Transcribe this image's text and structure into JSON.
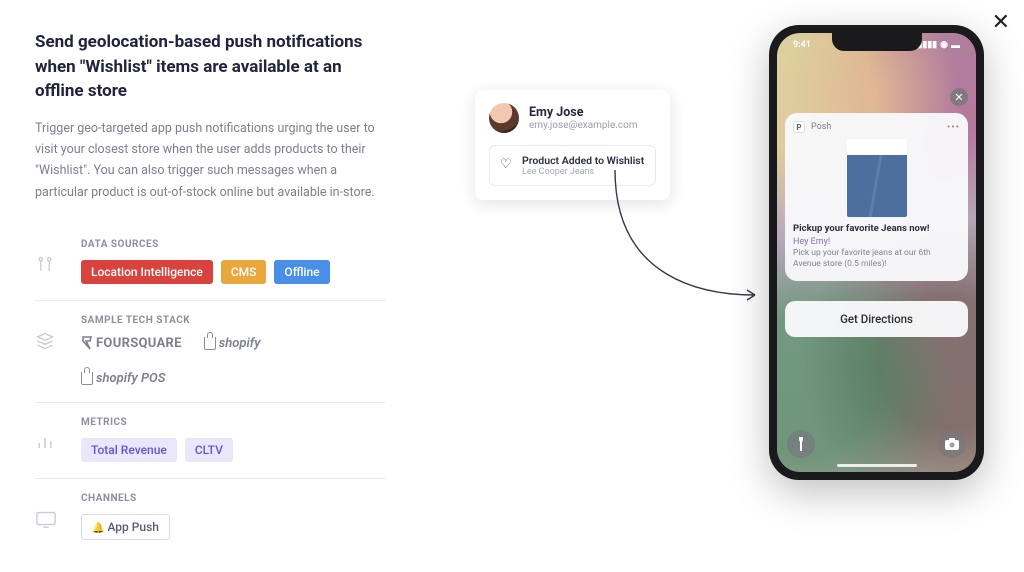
{
  "title": "Send geolocation-based push notifications when \"Wishlist\" items are available at an offline store",
  "description": "Trigger geo-targeted app push notifications urging the user to visit your closest store when the user adds products to their \"Wishlist\". You can also trigger such messages when a particular product is out-of-stock online but available in-store.",
  "sections": {
    "data_sources": {
      "label": "DATA SOURCES",
      "items": [
        "Location Intelligence",
        "CMS",
        "Offline"
      ]
    },
    "tech_stack": {
      "label": "SAMPLE TECH STACK",
      "items": [
        "FOURSQUARE",
        "shopify",
        "shopify POS"
      ]
    },
    "metrics": {
      "label": "METRICS",
      "items": [
        "Total Revenue",
        "CLTV"
      ]
    },
    "channels": {
      "label": "CHANNELS",
      "items": [
        "App Push"
      ]
    }
  },
  "scene": {
    "user_card": {
      "name": "Emy Jose",
      "email": "emy.jose@example.com",
      "event_title": "Product Added to Wishlist",
      "event_sub": "Lee Cooper Jeans"
    },
    "phone": {
      "time": "9:41",
      "app_name": "Posh",
      "app_letter": "P",
      "notif_title": "Pickup your favorite Jeans now!",
      "notif_greet": "Hey Emy!",
      "notif_body": "Pick up your favorite jeans at our 6th Avenue store (0.5 miles)!",
      "cta": "Get Directions"
    }
  }
}
